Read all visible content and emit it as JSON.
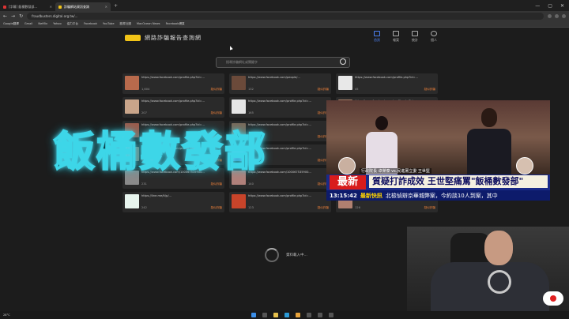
{
  "browser": {
    "tabs": [
      {
        "label": "[字幕] 飯桶數發部...",
        "active": false
      },
      {
        "label": "詐騙網站資訊查詢",
        "active": true
      }
    ],
    "url": "fraudbusters.digital.org.tw/...",
    "bookmarks": [
      "Google翻譯",
      "Gmail",
      "Netflix",
      "Yahoo",
      "協力平台",
      "Facebook",
      "YouTube",
      "臉書社團",
      "MacOcean News",
      "Facebook網頁"
    ]
  },
  "site": {
    "title": "網路詐騙報告查詢網",
    "nav": [
      {
        "icon": "home-icon",
        "label": "首頁",
        "active": true
      },
      {
        "icon": "report-icon",
        "label": "報案",
        "active": false
      },
      {
        "icon": "stats-icon",
        "label": "統計",
        "active": false
      },
      {
        "icon": "user-icon",
        "label": "個人",
        "active": false
      }
    ],
    "search_placeholder": "搜尋詐騙網址或關鍵字",
    "loading_text": "資料載入中..."
  },
  "cards": [
    {
      "title": "https://www.facebook.com/profile.php?id=...",
      "count": "1,604",
      "status": "疑似詐騙",
      "thumb_color": "#b86a4c"
    },
    {
      "title": "https://www.facebook.com/people/...",
      "count": "132",
      "status": "疑似詐騙",
      "thumb_color": "#6b4a3a"
    },
    {
      "title": "https://www.facebook.com/profile.php?id=...",
      "count": "45",
      "status": "疑似詐騙",
      "thumb_color": "#e8e8e8"
    },
    {
      "title": "https://www.facebook.com/profile.php?id=...",
      "count": "207",
      "status": "疑似詐騙",
      "thumb_color": "#c9a58a"
    },
    {
      "title": "https://www.facebook.com/profile.php?id=...",
      "count": "165",
      "status": "疑似詐騙",
      "thumb_color": "#e5e5e5"
    },
    {
      "title": "https://www.facebook.com/profile.php?id=...",
      "count": "63",
      "status": "疑似詐騙",
      "thumb_color": "#a77f68"
    },
    {
      "title": "https://www.facebook.com/profile.php?id=...",
      "count": "88",
      "status": "疑似詐騙",
      "thumb_color": "#9b5b4b"
    },
    {
      "title": "https://www.facebook.com/profile.php?id=...",
      "count": "120",
      "status": "疑似詐騙",
      "thumb_color": "#7a6a5a"
    },
    {
      "title": "https://www.facebook.com/profile.php?id=...",
      "count": "39",
      "status": "疑似詐騙",
      "thumb_color": "#cfc0b0"
    },
    {
      "title": "https://www.facebook.com/profile.php?id=...",
      "count": "54",
      "status": "疑似詐騙",
      "thumb_color": "#8a7a6a"
    },
    {
      "title": "https://www.facebook.com/profile.php?id=...",
      "count": "71",
      "status": "疑似詐騙",
      "thumb_color": "#5a8ac8"
    },
    {
      "title": "https://www.facebook.com/profile.php?id=...",
      "count": "96",
      "status": "疑似詐騙",
      "thumb_color": "#b89a8a"
    },
    {
      "title": "https://www.facebook.com/100067535900...",
      "count": "231",
      "status": "疑似詐騙",
      "thumb_color": "#8a8a8a"
    },
    {
      "title": "https://www.facebook.com/100067535900...",
      "count": "140",
      "status": "疑似詐騙",
      "thumb_color": "#b0807a"
    },
    {
      "title": "https://www.facebook.com/profile.php?id=...",
      "count": "47",
      "status": "疑似詐騙",
      "thumb_color": "#6a6a6a"
    },
    {
      "title": "https://line.me/ti/p/...",
      "count": "242",
      "status": "疑似詐騙",
      "thumb_color": "#e8f5ee"
    },
    {
      "title": "https://www.facebook.com/profile.php?id=...",
      "count": "123",
      "status": "疑似詐騙",
      "thumb_color": "#c8442a"
    },
    {
      "title": "https://www.facebook.com/profile.php?id=...",
      "count": "126",
      "status": "疑似詐騙",
      "thumb_color": "#b08070"
    }
  ],
  "overlay": {
    "title": "飯桶數發部"
  },
  "news": {
    "badge": "最新",
    "headline": "質疑打詐成效 王世堅痛罵\"飯桶數發部\"",
    "clock": "13:15:42",
    "flash": "最新快訊",
    "crawl": "北檢偵辦京華城弊案，今約談10人到案，其中",
    "caption": "行政院長 卓榮泰 vs.民進黨立委 王世堅"
  },
  "taskbar": {
    "weather": "28°C"
  }
}
